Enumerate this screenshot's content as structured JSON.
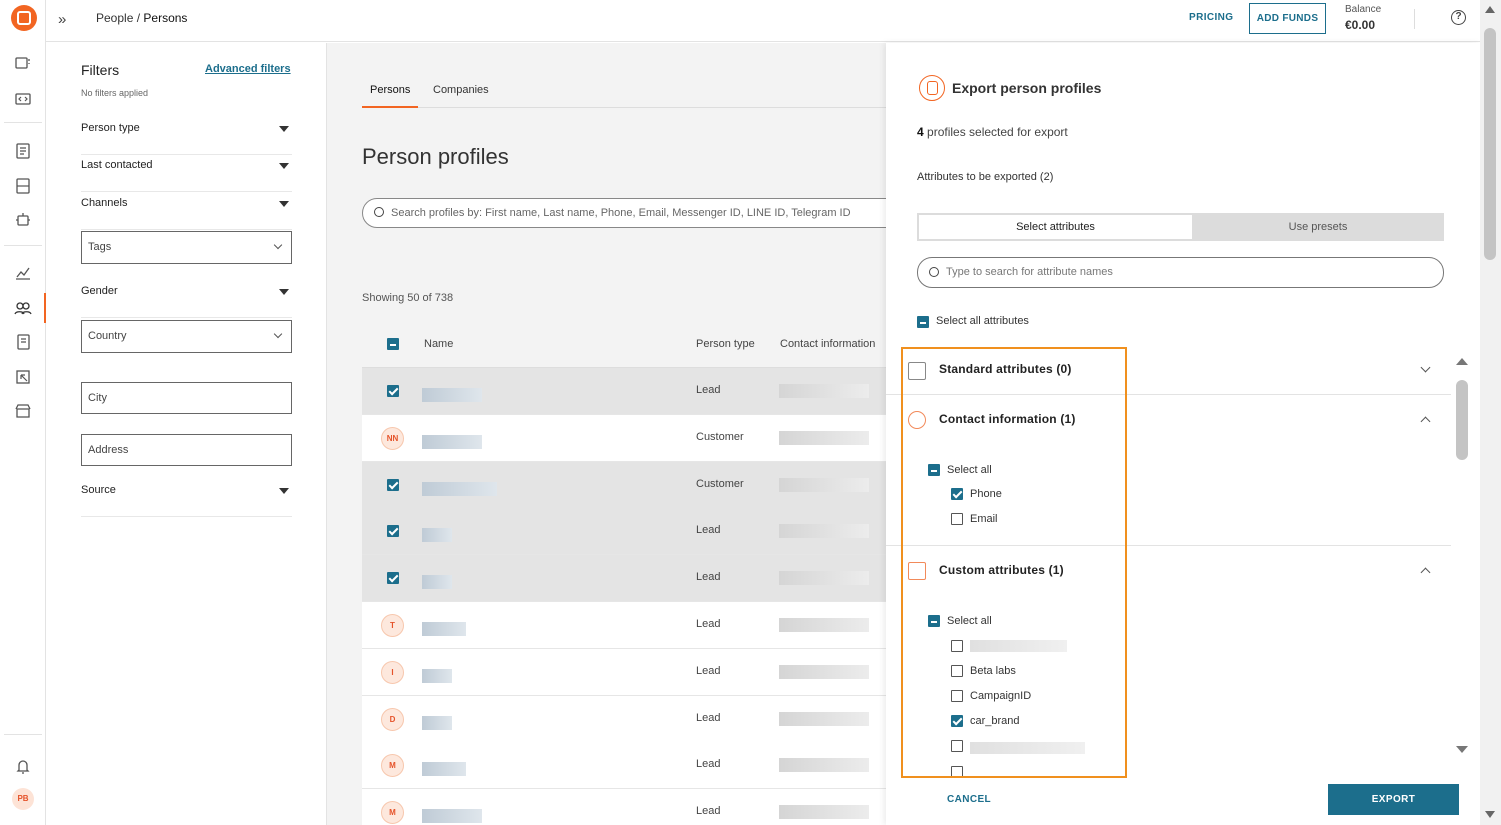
{
  "topbar": {
    "breadcrumb_parent": "People",
    "breadcrumb_sep": " / ",
    "breadcrumb_current": "Persons",
    "pricing": "PRICING",
    "add_funds": "ADD FUNDS",
    "balance_label": "Balance",
    "balance_value": "€0.00",
    "help": "?"
  },
  "rail": {
    "avatar": "PB",
    "icons": [
      "logo-icon",
      "conversations-icon",
      "code-icon",
      "templates-icon",
      "flows-icon",
      "bot-icon",
      "analytics-icon",
      "people-icon",
      "logs-icon",
      "broadcast-icon",
      "store-icon",
      "bell-icon"
    ]
  },
  "filters": {
    "title": "Filters",
    "advanced": "Advanced filters",
    "none": "No filters applied",
    "person_type": "Person type",
    "last_contacted": "Last contacted",
    "channels": "Channels",
    "tags": "Tags",
    "gender": "Gender",
    "country": "Country",
    "city": "City",
    "address": "Address",
    "source": "Source"
  },
  "main": {
    "tabs": [
      "Persons",
      "Companies"
    ],
    "title": "Person profiles",
    "search_placeholder": "Search profiles by: First name, Last name, Phone, Email, Messenger ID, LINE ID, Telegram ID",
    "showing": "Showing 50 of 738",
    "columns": [
      "Name",
      "Person type",
      "Contact information"
    ],
    "rows": [
      {
        "initials": "",
        "selected": true,
        "type": "Lead"
      },
      {
        "initials": "NN",
        "selected": false,
        "type": "Customer"
      },
      {
        "initials": "",
        "selected": true,
        "type": "Customer"
      },
      {
        "initials": "",
        "selected": true,
        "type": "Lead"
      },
      {
        "initials": "",
        "selected": true,
        "type": "Lead"
      },
      {
        "initials": "T",
        "selected": false,
        "type": "Lead"
      },
      {
        "initials": "I",
        "selected": false,
        "type": "Lead"
      },
      {
        "initials": "D",
        "selected": false,
        "type": "Lead"
      },
      {
        "initials": "M",
        "selected": false,
        "type": "Lead"
      },
      {
        "initials": "M",
        "selected": false,
        "type": "Lead"
      }
    ]
  },
  "export": {
    "title": "Export person profiles",
    "count": "4",
    "count_suffix": " profiles selected for export",
    "attributes_label": "Attributes to be exported (2)",
    "tab_select": "Select attributes",
    "tab_presets": "Use presets",
    "search_placeholder": "Type to search for attribute names",
    "select_all_attributes": "Select all attributes",
    "sections": {
      "standard": "Standard attributes (0)",
      "contact": "Contact information (1)",
      "custom": "Custom attributes (1)"
    },
    "select_all": "Select all",
    "contact_items": [
      {
        "label": "Phone",
        "checked": true
      },
      {
        "label": "Email",
        "checked": false
      }
    ],
    "custom_items": [
      {
        "label": "",
        "checked": false
      },
      {
        "label": "Beta labs",
        "checked": false
      },
      {
        "label": "CampaignID",
        "checked": false
      },
      {
        "label": "car_brand",
        "checked": true
      },
      {
        "label": "",
        "checked": false
      }
    ],
    "cancel": "CANCEL",
    "export": "EXPORT"
  }
}
